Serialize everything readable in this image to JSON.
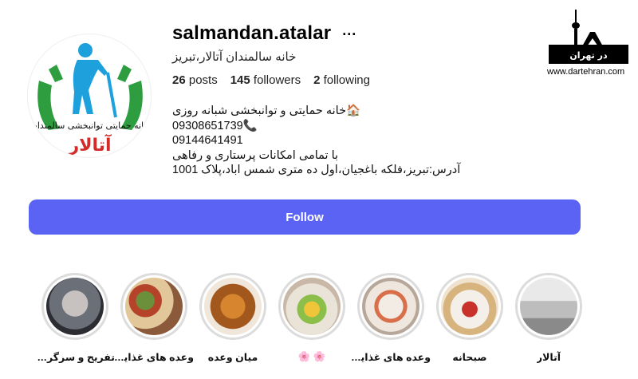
{
  "profile": {
    "username": "salmandan.atalar",
    "more_label": "···",
    "full_name": "خانه سالمندان آتالار،تبریز",
    "stats": {
      "posts_count": "26",
      "posts_label": "posts",
      "followers_count": "145",
      "followers_label": "followers",
      "following_count": "2",
      "following_label": "following"
    },
    "bio": [
      "🏠خانه حمایتی و توانبخشی شبانه روزی",
      "09308651739📞",
      "09144641491",
      "با تمامی امکانات پرستاری و رفاهی",
      "آدرس:تبریز،فلکه باغجیان،اول ده متری شمس اباد،پلاک 1001"
    ],
    "avatar_text": {
      "arc": "خانه حمایتی توانبخشی سالمندان",
      "name": "آتالار"
    }
  },
  "watermark": {
    "logo_text": "در تهران",
    "url": "www.dartehran.com"
  },
  "follow_button": {
    "label": "Follow"
  },
  "highlights": [
    {
      "label": "تفریح و سرگرمی"
    },
    {
      "label": "وعده های غذایـ..."
    },
    {
      "label": "میان وعده"
    },
    {
      "label": "🌸 🌸"
    },
    {
      "label": "وعده های غذایی"
    },
    {
      "label": "صبحانه"
    },
    {
      "label": "آتالار"
    }
  ],
  "colors": {
    "follow_bg": "#5b63f5",
    "logo_green": "#2e9d3f",
    "logo_blue": "#1ea0dc",
    "logo_red": "#d42a2a"
  }
}
